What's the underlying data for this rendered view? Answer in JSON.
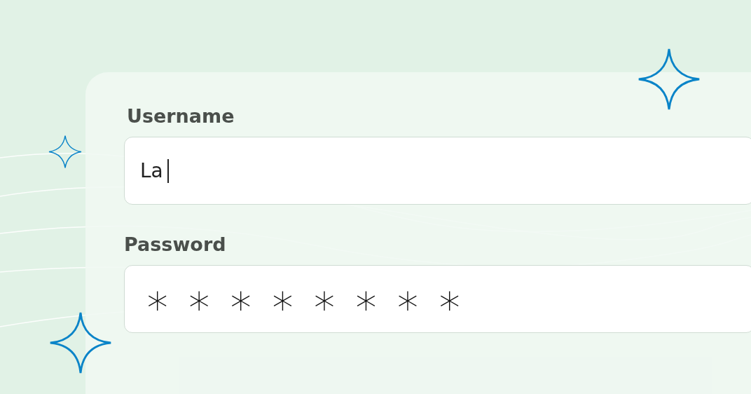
{
  "form": {
    "fields": [
      {
        "label": "Username",
        "kind": "text",
        "value": "La",
        "focused": true
      },
      {
        "label": "Password",
        "kind": "password",
        "value": "∗∗∗∗∗∗∗∗",
        "focused": false
      }
    ]
  }
}
